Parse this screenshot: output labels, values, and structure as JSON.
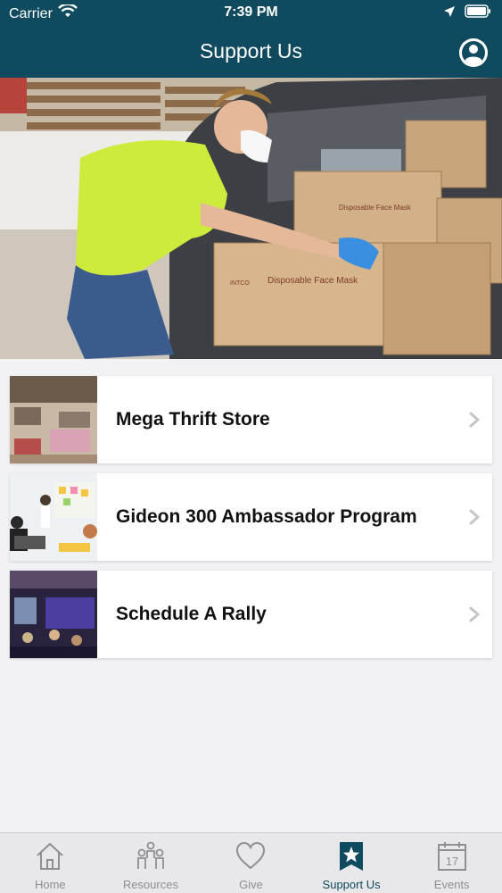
{
  "status": {
    "carrier": "Carrier",
    "time": "7:39 PM"
  },
  "nav": {
    "title": "Support Us"
  },
  "hero": {
    "box_label_main": "Disposable Face Mask",
    "box_label_side": "Disposable Face Mask",
    "brand": "INTCO"
  },
  "list": [
    {
      "title": "Mega Thrift Store"
    },
    {
      "title": "Gideon 300 Ambassador Program"
    },
    {
      "title": "Schedule A Rally"
    }
  ],
  "tabs": [
    {
      "label": "Home",
      "icon": "home-icon"
    },
    {
      "label": "Resources",
      "icon": "people-icon"
    },
    {
      "label": "Give",
      "icon": "heart-icon"
    },
    {
      "label": "Support Us",
      "icon": "star-badge-icon"
    },
    {
      "label": "Events",
      "icon": "calendar-icon"
    }
  ],
  "events_calendar_day": "17",
  "colors": {
    "header": "#0f4a5e",
    "active_tab": "#0f4a5e",
    "inactive_tab": "#8e8e93"
  }
}
